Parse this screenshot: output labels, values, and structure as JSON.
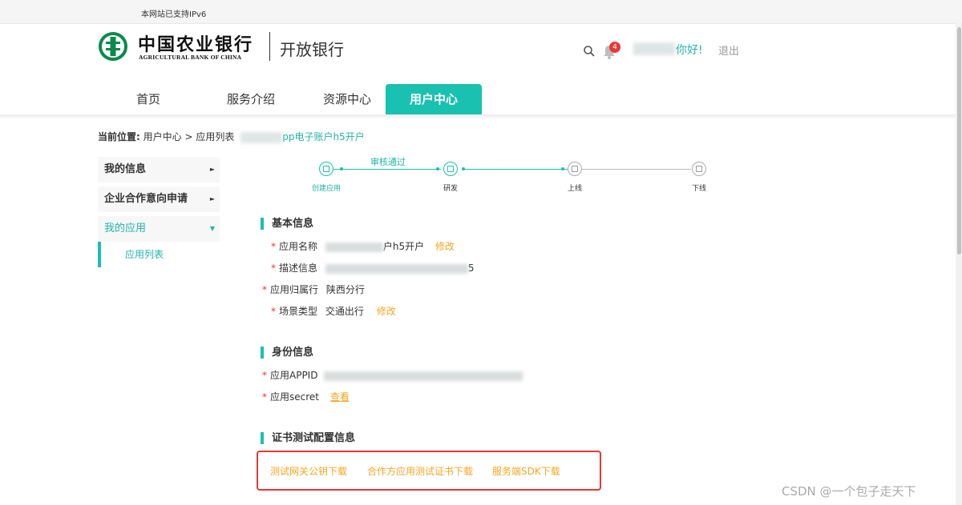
{
  "topbar": {
    "ipv6_notice": "本网站已支持IPv6"
  },
  "header": {
    "logo_cn": "中国农业银行",
    "logo_en": "AGRICULTURAL BANK OF CHINA",
    "site_name": "开放银行",
    "notification_count": "4",
    "greeting": "你好!",
    "logout": "退出"
  },
  "nav": {
    "items": [
      {
        "label": "首页"
      },
      {
        "label": "服务介绍"
      },
      {
        "label": "资源中心"
      },
      {
        "label": "用户中心"
      }
    ]
  },
  "breadcrumb": {
    "label": "当前位置:",
    "crumb1": "用户中心",
    "sep": ">",
    "crumb2": "应用列表",
    "current": "pp电子账户h5开户"
  },
  "sidebar": {
    "items": [
      {
        "label": "我的信息",
        "arrow": "►"
      },
      {
        "label": "企业合作意向申请",
        "arrow": "►"
      },
      {
        "label": "我的应用",
        "arrow": "▼"
      }
    ],
    "sub_item": "应用列表"
  },
  "steps": {
    "status_text": "审核通过",
    "labels": [
      "创建应用",
      "研发",
      "上线",
      "下线"
    ]
  },
  "basic_info": {
    "title": "基本信息",
    "app_name_label": "应用名称",
    "app_name_tail": "户h5开户",
    "modify": "修改",
    "desc_label": "描述信息",
    "desc_tail": "5",
    "branch_label": "应用归属行",
    "branch_value": "陕西分行",
    "scene_label": "场景类型",
    "scene_value": "交通出行",
    "scene_modify": "修改"
  },
  "identity_info": {
    "title": "身份信息",
    "appid_label": "应用APPID",
    "secret_label": "应用secret",
    "view": "查看"
  },
  "cert_info": {
    "title": "证书测试配置信息",
    "links": [
      "测试网关公钥下载",
      "合作方应用测试证书下载",
      "服务端SDK下载"
    ]
  },
  "watermark": "CSDN @一个包子走天下",
  "colors": {
    "accent": "#1ac0b0",
    "link": "#f5a623",
    "required": "#e53935"
  }
}
